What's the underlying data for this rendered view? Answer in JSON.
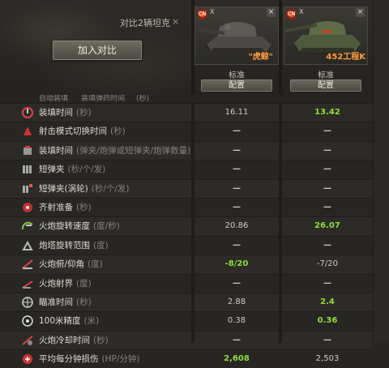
{
  "header": {
    "compare_title": "对比2辆坦克",
    "close_symbol": "×",
    "add_button": "加入对比"
  },
  "tanks": [
    {
      "name": "\"虎鲸\"",
      "tier": "X",
      "config": "标准",
      "config_button": "配置",
      "close": "×",
      "nation_flag": "CN",
      "accent": "#ff9b3a"
    },
    {
      "name": "452工程K",
      "tier": "X",
      "config": "标准",
      "config_button": "配置",
      "close": "×",
      "nation_flag": "CN",
      "accent": "#ff9b3a"
    }
  ],
  "cutoff_row": {
    "label": "自动装填",
    "unit": "装填弹药时间",
    "suffix": "(秒)"
  },
  "rows": [
    {
      "icon": "reload-icon",
      "label": "装填时间",
      "unit": "(秒)",
      "v1": "16.11",
      "v2": "13.42",
      "v2_good": true
    },
    {
      "icon": "fire-mode-icon",
      "label": "射击模式切换时间",
      "unit": "(秒)",
      "v1": "—",
      "v2": "—"
    },
    {
      "icon": "magazine-reload-icon",
      "label": "装填时间",
      "unit": "(弹夹/炮弹或短弹夹/炮弹数量)",
      "v1": "—",
      "v2": "—"
    },
    {
      "icon": "clip-icon",
      "label": "短弹夹",
      "unit": "(秒/个/发)",
      "v1": "—",
      "v2": "—"
    },
    {
      "icon": "turbo-clip-icon",
      "label": "短弹夹(涡轮)",
      "unit": "(秒/个/发)",
      "v1": "—",
      "v2": "—"
    },
    {
      "icon": "salvo-icon",
      "label": "齐射准备",
      "unit": "(秒)",
      "v1": "—",
      "v2": "—"
    },
    {
      "icon": "gun-traverse-icon",
      "label": "火炮旋转速度",
      "unit": "(度/秒)",
      "v1": "20.86",
      "v2": "26.07",
      "v2_good": true
    },
    {
      "icon": "turret-arc-icon",
      "label": "炮塔旋转范围",
      "unit": "(度)",
      "v1": "—",
      "v2": "—"
    },
    {
      "icon": "elevation-icon",
      "label": "火炮俯/仰角",
      "unit": "(度)",
      "v1": "-8/20",
      "v2": "-7/20",
      "v1_good": true
    },
    {
      "icon": "gun-arc-icon",
      "label": "火炮射界",
      "unit": "(度)",
      "v1": "—",
      "v2": "—"
    },
    {
      "icon": "aim-time-icon",
      "label": "瞄准时间",
      "unit": "(秒)",
      "v1": "2.88",
      "v2": "2.4",
      "v2_good": true
    },
    {
      "icon": "accuracy-icon",
      "label": "100米精度",
      "unit": "(米)",
      "v1": "0.38",
      "v2": "0.36",
      "v2_good": true
    },
    {
      "icon": "cooldown-icon",
      "label": "火炮冷却时间",
      "unit": "(秒)",
      "v1": "—",
      "v2": "—"
    },
    {
      "icon": "dpm-icon",
      "label": "平均每分钟损伤",
      "unit": "(HP/分钟)",
      "v1": "2,608",
      "v2": "2,503",
      "v1_good": true
    }
  ],
  "colors": {
    "good": "#8fde3a",
    "accent": "#ff9b3a",
    "background": "#262523"
  }
}
